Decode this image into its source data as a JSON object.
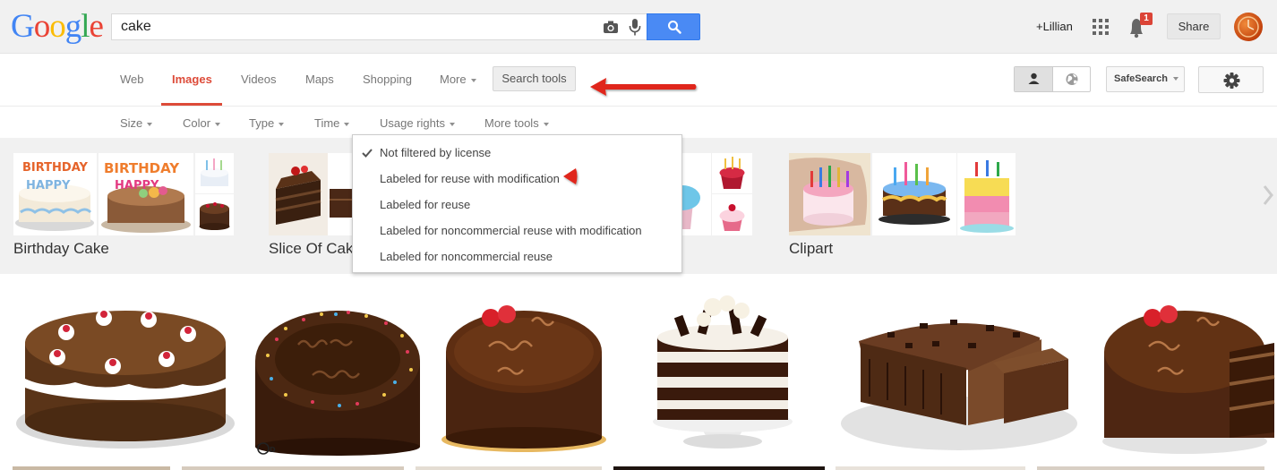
{
  "logo": {
    "letters": [
      {
        "ch": "G",
        "color": "#4285f4"
      },
      {
        "ch": "o",
        "color": "#ea4335"
      },
      {
        "ch": "o",
        "color": "#fbbc05"
      },
      {
        "ch": "g",
        "color": "#4285f4"
      },
      {
        "ch": "l",
        "color": "#34a853"
      },
      {
        "ch": "e",
        "color": "#ea4335"
      }
    ]
  },
  "search": {
    "query": "cake"
  },
  "header": {
    "user": "+Lillian",
    "notification_count": "1",
    "share_label": "Share"
  },
  "nav": {
    "tabs": [
      "Web",
      "Images",
      "Videos",
      "Maps",
      "Shopping",
      "More"
    ],
    "active_tab": "Images",
    "search_tools_label": "Search tools",
    "safesearch_label": "SafeSearch"
  },
  "tools": [
    "Size",
    "Color",
    "Type",
    "Time",
    "Usage rights",
    "More tools"
  ],
  "usage_rights_menu": {
    "items": [
      "Not filtered by license",
      "Labeled for reuse with modification",
      "Labeled for reuse",
      "Labeled for noncommercial reuse with modification",
      "Labeled for noncommercial reuse"
    ],
    "selected": "Not filtered by license"
  },
  "categories": [
    {
      "label": "Birthday Cake"
    },
    {
      "label": "Slice Of Cake"
    },
    {
      "label": "Cupcake"
    },
    {
      "label": "Clipart"
    }
  ],
  "colors": {
    "accent_red": "#dd4b39",
    "search_blue": "#4a8af4",
    "arrow_red": "#e0281c"
  },
  "results": {
    "watermark": "D"
  }
}
